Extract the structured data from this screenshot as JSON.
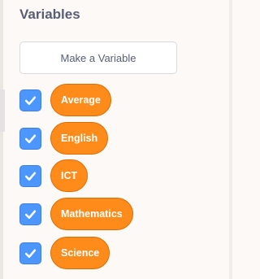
{
  "panel": {
    "heading": "Variables",
    "make_variable_label": "Make a Variable"
  },
  "variables": [
    {
      "name": "Average",
      "checked": true
    },
    {
      "name": "English",
      "checked": true
    },
    {
      "name": "ICT",
      "checked": true
    },
    {
      "name": "Mathematics",
      "checked": true
    },
    {
      "name": "Science",
      "checked": true
    }
  ],
  "colors": {
    "checkbox": "#4c97ff",
    "variable_block": "#ff8c1a",
    "heading_text": "#575e75"
  },
  "icons": {
    "checkbox_mark": "check-icon"
  }
}
